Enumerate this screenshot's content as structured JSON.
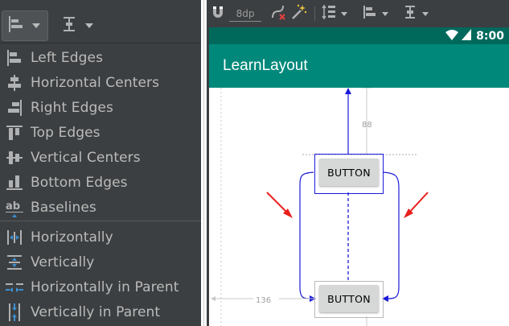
{
  "align_menu": {
    "items": [
      {
        "label": "Left Edges",
        "icon": "align-left-edges-icon"
      },
      {
        "label": "Horizontal Centers",
        "icon": "align-horizontal-centers-icon"
      },
      {
        "label": "Right Edges",
        "icon": "align-right-edges-icon"
      },
      {
        "label": "Top Edges",
        "icon": "align-top-edges-icon"
      },
      {
        "label": "Vertical Centers",
        "icon": "align-vertical-centers-icon"
      },
      {
        "label": "Bottom Edges",
        "icon": "align-bottom-edges-icon"
      },
      {
        "label": "Baselines",
        "icon": "align-baselines-icon"
      }
    ],
    "center_items": [
      {
        "label": "Horizontally",
        "icon": "center-horizontally-icon"
      },
      {
        "label": "Vertically",
        "icon": "center-vertically-icon"
      },
      {
        "label": "Horizontally in Parent",
        "icon": "center-horizontally-in-parent-icon"
      },
      {
        "label": "Vertically in Parent",
        "icon": "center-vertically-in-parent-icon"
      }
    ],
    "baseline_glyph": "ab"
  },
  "editor_toolbar": {
    "default_margin": "8dp"
  },
  "device": {
    "status_time": "8:00",
    "app_title": "LearnLayout"
  },
  "layout": {
    "buttons": [
      {
        "label": "BUTTON"
      },
      {
        "label": "BUTTON"
      }
    ],
    "margin_top_label": "88",
    "margin_left_label": "136"
  },
  "colors": {
    "menu_bg": "#3c3f41",
    "menu_text": "#bbbbbb",
    "icon_color": "#afb1b3",
    "status_bar": "#00695c",
    "app_bar": "#00897b",
    "constraint_blue": "#1a1ad9",
    "annotation_arrow": "#e8201c"
  }
}
